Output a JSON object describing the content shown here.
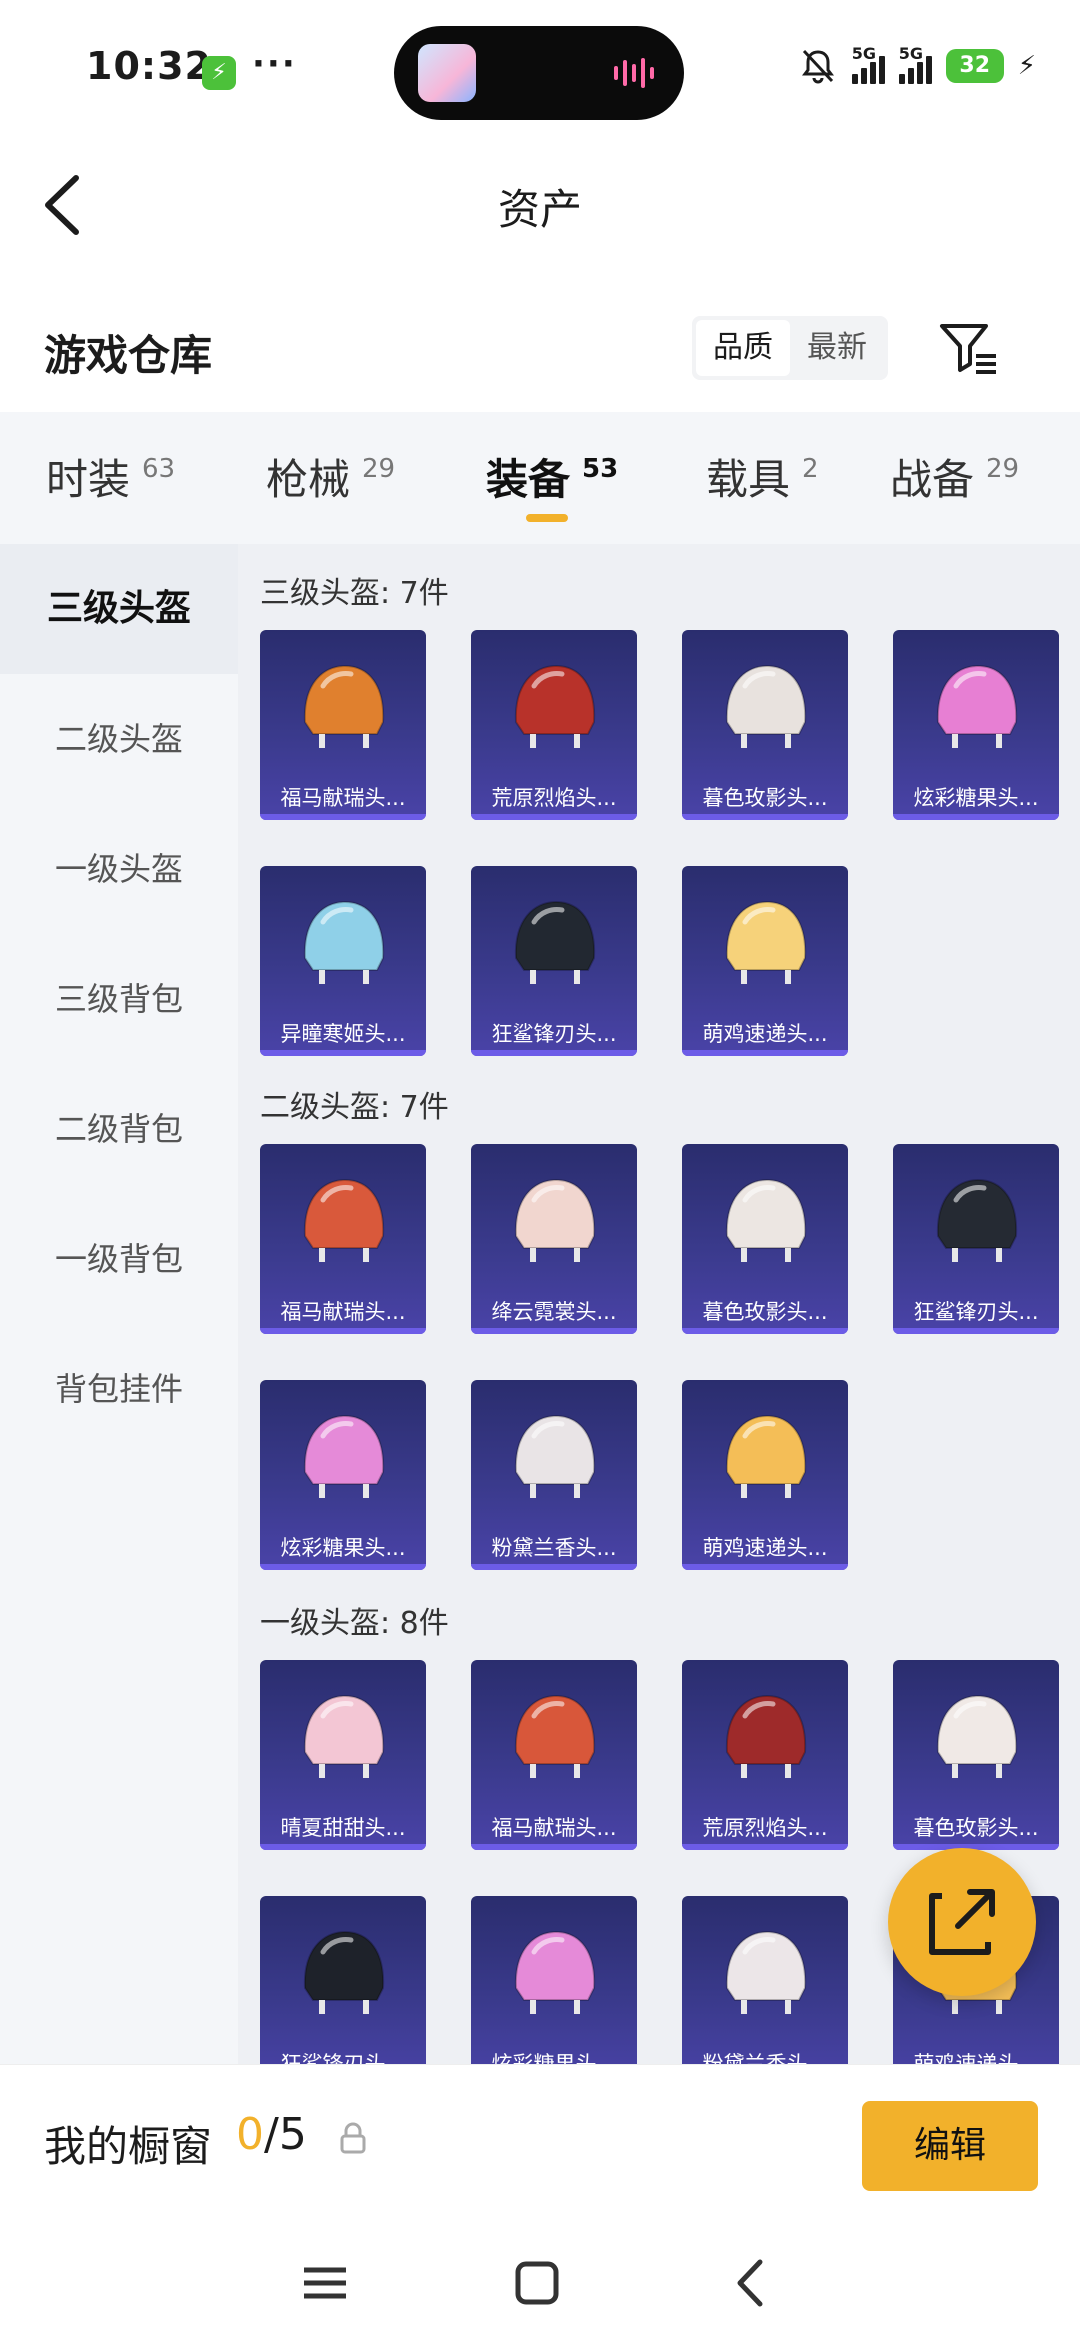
{
  "status_bar": {
    "time": "10:32",
    "more": "···",
    "network_1": "5G",
    "network_2": "5G",
    "battery": "32"
  },
  "header": {
    "title": "资产"
  },
  "warehouse": {
    "title": "游戏仓库",
    "sort_options": [
      "品质",
      "最新"
    ],
    "active_sort": "品质"
  },
  "tabs": [
    {
      "label": "时装",
      "count": "63"
    },
    {
      "label": "枪械",
      "count": "29"
    },
    {
      "label": "装备",
      "count": "53",
      "active": true
    },
    {
      "label": "载具",
      "count": "2"
    },
    {
      "label": "战备",
      "count": "29"
    }
  ],
  "sidebar": {
    "items": [
      "三级头盔",
      "二级头盔",
      "一级头盔",
      "三级背包",
      "二级背包",
      "一级背包",
      "背包挂件"
    ],
    "active": "三级头盔"
  },
  "sections": [
    {
      "title": "三级头盔: 7件",
      "items": [
        {
          "name": "福马献瑞头...",
          "color": "#e0802e"
        },
        {
          "name": "荒原烈焰头...",
          "color": "#b8322a"
        },
        {
          "name": "暮色玫影头...",
          "color": "#e8e2de"
        },
        {
          "name": "炫彩糖果头...",
          "color": "#e77fd3"
        },
        {
          "name": "异瞳寒姬头...",
          "color": "#8fd0e8"
        },
        {
          "name": "狂鲨锋刃头...",
          "color": "#222831"
        },
        {
          "name": "萌鸡速递头...",
          "color": "#f6d27a"
        }
      ]
    },
    {
      "title": "二级头盔: 7件",
      "items": [
        {
          "name": "福马献瑞头...",
          "color": "#d9593b"
        },
        {
          "name": "绛云霓裳头...",
          "color": "#f1d6cf"
        },
        {
          "name": "暮色玫影头...",
          "color": "#ece6e2"
        },
        {
          "name": "狂鲨锋刃头...",
          "color": "#252a33"
        },
        {
          "name": "炫彩糖果头...",
          "color": "#e58ad8"
        },
        {
          "name": "粉黛兰香头...",
          "color": "#e9e4e6"
        },
        {
          "name": "萌鸡速递头...",
          "color": "#f4be57"
        }
      ]
    },
    {
      "title": "一级头盔: 8件",
      "items": [
        {
          "name": "晴夏甜甜头...",
          "color": "#f3c6d4"
        },
        {
          "name": "福马献瑞头...",
          "color": "#d8573a"
        },
        {
          "name": "荒原烈焰头...",
          "color": "#9e2a2a"
        },
        {
          "name": "暮色玫影头...",
          "color": "#f0e9e6"
        },
        {
          "name": "狂鲨锋刃头...",
          "color": "#1e222a"
        },
        {
          "name": "炫彩糖果头...",
          "color": "#e58ad8"
        },
        {
          "name": "粉黛兰香头...",
          "color": "#ece6e8"
        },
        {
          "name": "萌鸡速递头...",
          "color": "#f4be57"
        }
      ]
    }
  ],
  "showcase": {
    "label": "我的橱窗",
    "current": "0",
    "total": "/5",
    "edit_label": "编辑"
  },
  "colors": {
    "accent": "#f2b12b",
    "card_bg": "#3a3a8c"
  }
}
